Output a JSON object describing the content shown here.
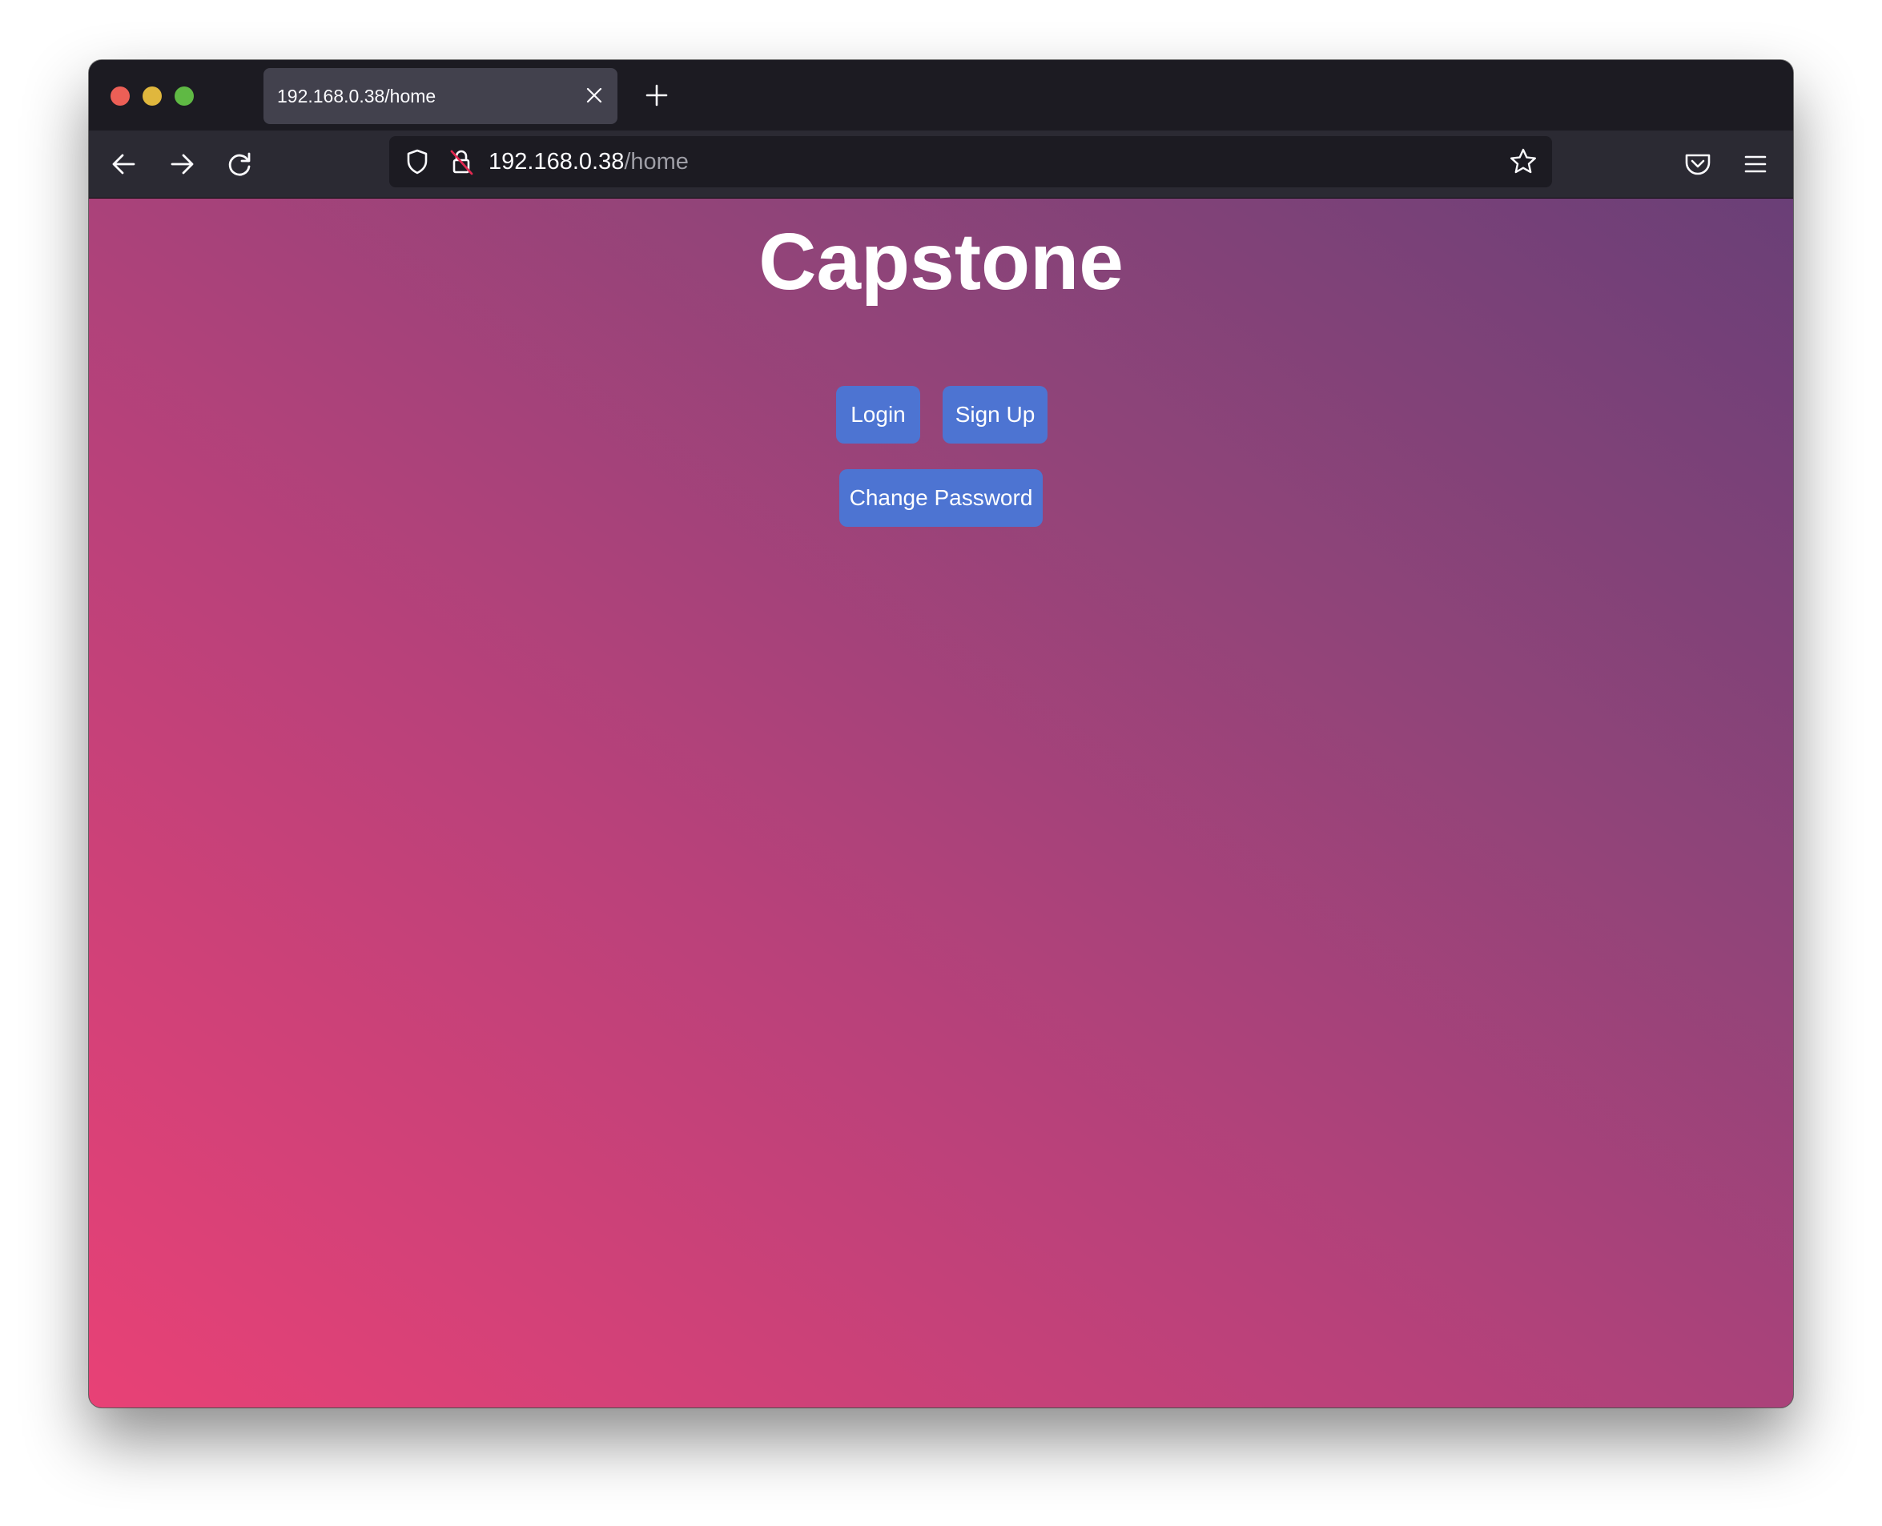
{
  "browser": {
    "tab": {
      "title": "192.168.0.38/home"
    },
    "address_bar": {
      "host": "192.168.0.38",
      "path": "/home"
    },
    "icons": {
      "back": "arrow-left-icon",
      "forward": "arrow-right-icon",
      "reload": "reload-icon",
      "tracking_protection": "shield-icon",
      "insecure": "insecure-lock-icon",
      "bookmark": "star-icon",
      "pocket": "pocket-icon",
      "menu": "hamburger-menu-icon",
      "new_tab": "plus-icon",
      "close_tab": "close-icon"
    },
    "colors": {
      "traffic_close": "#ec5f56",
      "traffic_minimize": "#e0b73d",
      "traffic_zoom": "#5fb944"
    }
  },
  "page": {
    "title": "Capstone",
    "buttons": {
      "login": "Login",
      "signup": "Sign Up",
      "change_password": "Change Password"
    },
    "colors": {
      "button_bg": "#4d74d2",
      "gradient_start": "#e84176",
      "gradient_end": "#6a3f77"
    }
  }
}
